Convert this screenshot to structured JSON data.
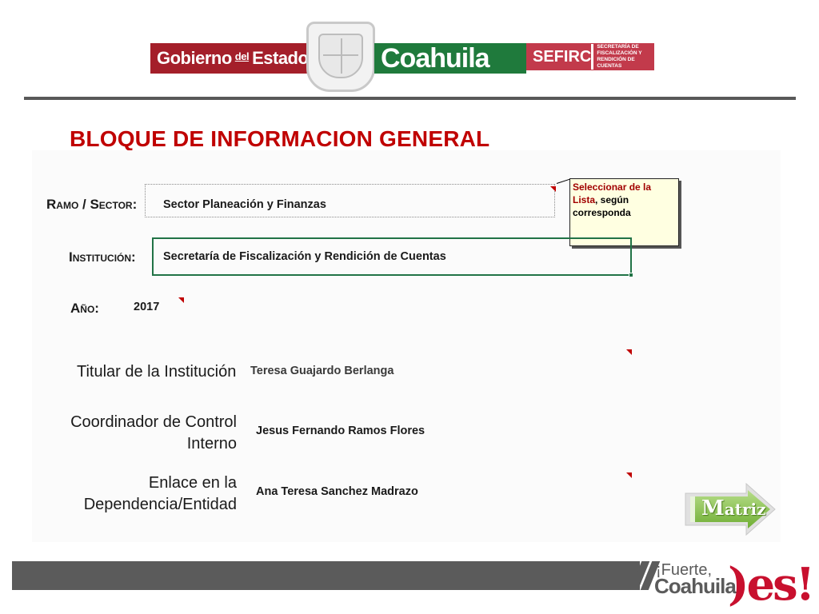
{
  "header": {
    "gobierno_text": "Gobierno",
    "del_text": "del",
    "estado_text": "Estado",
    "state_text": "Coahuila",
    "agency_acronym": "SEFIRC",
    "agency_sub": "SECRETARÍA DE FISCALIZACIÓN Y RENDICIÓN DE CUENTAS",
    "colors": {
      "red": "#a41f2a",
      "green": "#1f7a3c",
      "pink_red": "#c23a4b"
    }
  },
  "title": "BLOQUE DE INFORMACION GENERAL",
  "form": {
    "ramo_label": "Ramo / Sector:",
    "ramo_value": "Sector Planeación y Finanzas",
    "institucion_label": "Institución:",
    "institucion_value": "Secretaría de Fiscalización y Rendición de Cuentas",
    "anio_label": "Año:",
    "anio_value": "2017",
    "titular_label": "Titular de la Institución",
    "titular_value": "Teresa Guajardo Berlanga",
    "coordinador_label_1": "Coordinador de Control",
    "coordinador_label_2": "Interno",
    "coordinador_value": "Jesus Fernando Ramos Flores",
    "enlace_label_1": "Enlace en la",
    "enlace_label_2": "Dependencia/Entidad",
    "enlace_value": "Ana Teresa Sanchez Madrazo"
  },
  "comment": {
    "part1": "Seleccionar de la",
    "part2": "Lista",
    "part3": ", según",
    "part4": "corresponda"
  },
  "matriz_button": {
    "label_first": "M",
    "label_rest": "atriz"
  },
  "footer": {
    "fuerte_text": "¡Fuerte,",
    "coahuila_text": "Coahuila",
    "es_text": ")es!"
  }
}
